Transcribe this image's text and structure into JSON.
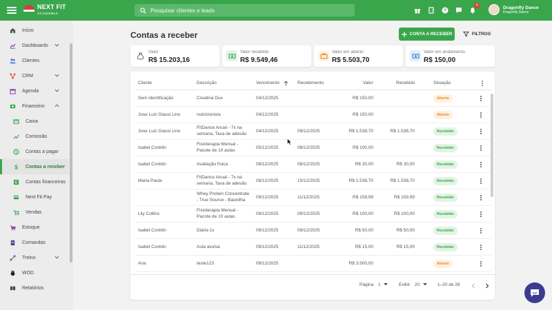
{
  "brand": {
    "name": "NEXT FIT",
    "sub": "ACADEMIA"
  },
  "search": {
    "placeholder": "Pesquisar clientes e leads"
  },
  "top_icons": [
    "gift-icon",
    "door-icon",
    "help-icon",
    "chat-icon",
    "bell-icon"
  ],
  "notifications": {
    "count": "4"
  },
  "user": {
    "name": "Dragonfly Dance",
    "subtitle": "Dragonfly Dance"
  },
  "sidebar": {
    "items": [
      {
        "label": "Início",
        "icon": "home-icon"
      },
      {
        "label": "Dashboards",
        "icon": "chart-icon",
        "expandable": true
      },
      {
        "label": "Clientes",
        "icon": "people-icon"
      },
      {
        "label": "CRM",
        "icon": "crm-icon",
        "expandable": true
      },
      {
        "label": "Agenda",
        "icon": "calendar-icon",
        "expandable": true
      },
      {
        "label": "Financeiro",
        "icon": "finance-icon",
        "expanded": true
      },
      {
        "label": "Caixa",
        "icon": "cash-icon"
      },
      {
        "label": "Comissão",
        "icon": "trend-icon"
      },
      {
        "label": "Contas a pagar",
        "icon": "pay-icon"
      },
      {
        "label": "Contas a receber",
        "icon": "dollar-icon",
        "active": true
      },
      {
        "label": "Contas financeiras",
        "icon": "wallet-icon"
      },
      {
        "label": "Next Fit Pay",
        "icon": "card-icon"
      },
      {
        "label": "Vendas",
        "icon": "cart-icon"
      },
      {
        "label": "Estoque",
        "icon": "cart-icon"
      },
      {
        "label": "Comandas",
        "icon": "doc-icon"
      },
      {
        "label": "Treino",
        "icon": "dumbbell-icon",
        "expandable": true
      },
      {
        "label": "WOD",
        "icon": "kettlebell-icon"
      },
      {
        "label": "Relatórios",
        "icon": "report-icon"
      }
    ]
  },
  "page": {
    "title": "Contas a receber",
    "new_button": "CONTA A RECEBER",
    "filter_button": "FILTROS"
  },
  "summary": [
    {
      "label": "Valor",
      "value": "R$ 15.203,16",
      "color": "#ffffff"
    },
    {
      "label": "Valor recebido",
      "value": "R$ 9.549,46",
      "color": "#e2f4e4"
    },
    {
      "label": "Valor em aberto",
      "value": "R$ 5.503,70",
      "color": "#fff1e0"
    },
    {
      "label": "Valor em andamento",
      "value": "R$ 150,00",
      "color": "#e1f0fb"
    }
  ],
  "table": {
    "columns": [
      "Cliente",
      "Descrição",
      "Vencimento",
      "Recebimento",
      "Valor",
      "Recebido",
      "Situação"
    ],
    "rows": [
      {
        "cliente": "Sem identificação",
        "descricao": [
          "Creatina Dux"
        ],
        "vencimento": "04/12/2025",
        "recebimento": "",
        "valor": "R$ 150,00",
        "recebido": "",
        "situacao": "Aberto"
      },
      {
        "cliente": "Jose Luiz Giassi Lino",
        "descricao": [
          "nutricionista"
        ],
        "vencimento": "04/12/2025",
        "recebimento": "",
        "valor": "R$ 150,00",
        "recebido": "",
        "situacao": "Aberto"
      },
      {
        "cliente": "Jose Luiz Giassi Lino",
        "descricao": [
          "FitDance Anual - 7x na",
          "semana, Taxa de adesão"
        ],
        "vencimento": "04/12/2025",
        "recebimento": "09/12/2025",
        "valor": "R$ 1.538,70",
        "recebido": "R$ 1.538,70",
        "situacao": "Recebido"
      },
      {
        "cliente": "Isabel Conklin",
        "descricao": [
          "Fisioterapia Mensal -",
          "Pacote de 10 aulas"
        ],
        "vencimento": "05/12/2025",
        "recebimento": "08/12/2025",
        "valor": "R$ 100,00",
        "recebido": "",
        "situacao": "Recebido"
      },
      {
        "cliente": "Isabel Conklin",
        "descricao": [
          "Avaliação física"
        ],
        "vencimento": "08/12/2025",
        "recebimento": "08/12/2025",
        "valor": "R$ 30,00",
        "recebido": "R$ 30,00",
        "situacao": "Recebido"
      },
      {
        "cliente": "Maria Paula",
        "descricao": [
          "FitDance Anual - 7x na",
          "semana, Taxa de adesão"
        ],
        "vencimento": "08/12/2025",
        "recebimento": "15/12/2025",
        "valor": "R$ 1.538,70",
        "recebido": "R$ 1.538,70",
        "situacao": "Recebido"
      },
      {
        "cliente": "",
        "descricao": [
          "Whey Protein Concentrate",
          "- True Source - Baunilha"
        ],
        "vencimento": "09/12/2025",
        "recebimento": "11/12/2025",
        "valor": "R$ 159,99",
        "recebido": "R$ 159,99",
        "situacao": "Recebido"
      },
      {
        "cliente": "Lily Collins",
        "descricao": [
          "Fisioterapia Mensal -",
          "Pacote de 10 aulas"
        ],
        "vencimento": "09/12/2025",
        "recebimento": "09/12/2025",
        "valor": "R$ 100,00",
        "recebido": "R$ 100,00",
        "situacao": "Recebido"
      },
      {
        "cliente": "Isabel Conklin",
        "descricao": [
          "Diária 1x"
        ],
        "vencimento": "09/12/2025",
        "recebimento": "09/12/2025",
        "valor": "R$ 50,00",
        "recebido": "R$ 50,00",
        "situacao": "Recebido"
      },
      {
        "cliente": "Isabel Conklin",
        "descricao": [
          "Aula avulsa"
        ],
        "vencimento": "09/12/2025",
        "recebimento": "11/12/2025",
        "valor": "R$ 15,00",
        "recebido": "R$ 15,00",
        "situacao": "Recebido"
      },
      {
        "cliente": "Ana",
        "descricao": [
          "teste123"
        ],
        "vencimento": "09/12/2025",
        "recebimento": "",
        "valor": "R$ 3.500,00",
        "recebido": "",
        "situacao": "Aberto"
      }
    ]
  },
  "pagination": {
    "page_label": "Página",
    "page_value": "1",
    "show_label": "Exibir",
    "show_value": "20",
    "range": "1–20 de 28"
  },
  "colors": {
    "brand": "#3aa64c",
    "aberto": "#e08a1e",
    "recebido": "#3aa64c",
    "chat": "#3c3b8f"
  }
}
